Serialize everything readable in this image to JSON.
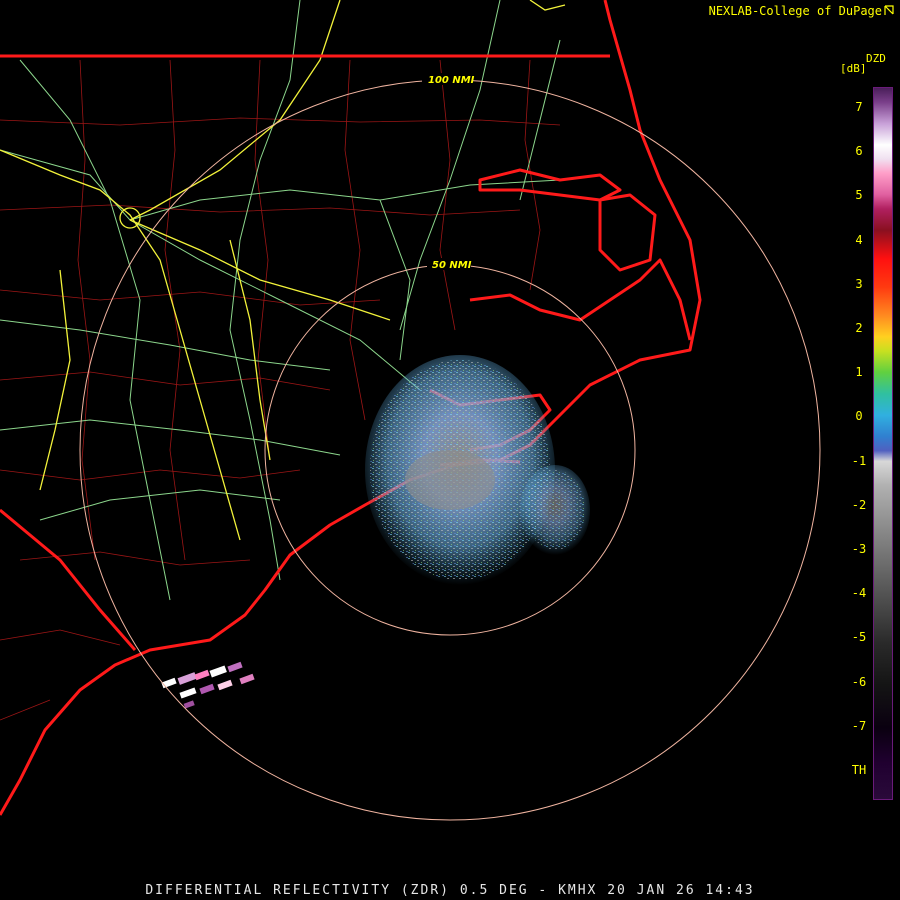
{
  "credit": "NEXLAB-College of DuPage",
  "credit_icon": "cursor-arrow-icon",
  "footer": "DIFFERENTIAL REFLECTIVITY (ZDR) 0.5 DEG - KMHX 20 JAN 26 14:43",
  "range_rings": [
    {
      "label": "100 NMI"
    },
    {
      "label": "50 NMI"
    }
  ],
  "legend": {
    "title": "DZD",
    "unit": "[dB]",
    "ticks": [
      "7",
      "6",
      "5",
      "4",
      "3",
      "2",
      "1",
      "0",
      "-1",
      "-2",
      "-3",
      "-4",
      "-5",
      "-6",
      "-7",
      "TH"
    ]
  },
  "colors": {
    "state_borders": "#ff1a1a",
    "county_borders": "#c81e1e",
    "highways": "#8cd68c",
    "interstates": "#ffff33",
    "range_rings": "#f0b4a0",
    "labels": "#ffff00"
  }
}
